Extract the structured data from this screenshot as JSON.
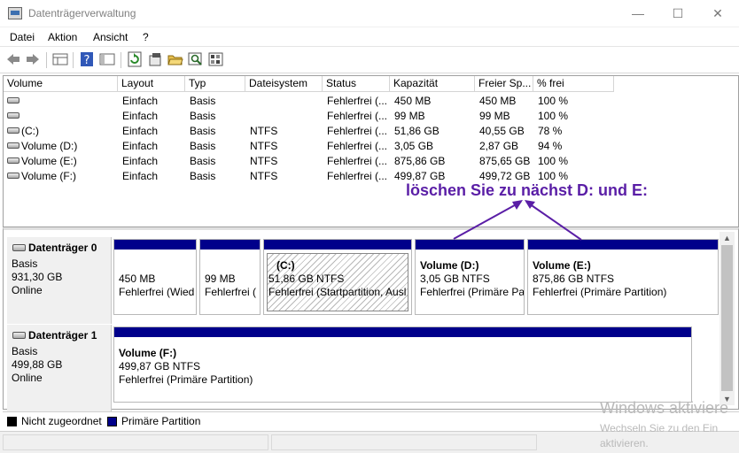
{
  "window": {
    "title": "Datenträgerverwaltung",
    "minimize": "—",
    "maximize": "☐",
    "close": "✕"
  },
  "menu": [
    "Datei",
    "Aktion",
    "Ansicht",
    "?"
  ],
  "toolbar": {
    "icons": [
      "back-arrow-icon",
      "forward-arrow-icon",
      "disk-list-icon",
      "help-icon",
      "console-tree-icon",
      "refresh-icon",
      "properties-icon",
      "open-folder-icon",
      "search-disk-icon",
      "rescan-icon"
    ]
  },
  "columns": [
    "Volume",
    "Layout",
    "Typ",
    "Dateisystem",
    "Status",
    "Kapazität",
    "Freier Sp...",
    "% frei"
  ],
  "volumes": [
    {
      "name": "",
      "layout": "Einfach",
      "type": "Basis",
      "fs": "",
      "status": "Fehlerfrei (...",
      "capacity": "450 MB",
      "free": "450 MB",
      "pct": "100 %"
    },
    {
      "name": "",
      "layout": "Einfach",
      "type": "Basis",
      "fs": "",
      "status": "Fehlerfrei (...",
      "capacity": "99 MB",
      "free": "99 MB",
      "pct": "100 %"
    },
    {
      "name": "(C:)",
      "layout": "Einfach",
      "type": "Basis",
      "fs": "NTFS",
      "status": "Fehlerfrei (...",
      "capacity": "51,86 GB",
      "free": "40,55 GB",
      "pct": "78 %"
    },
    {
      "name": "Volume (D:)",
      "layout": "Einfach",
      "type": "Basis",
      "fs": "NTFS",
      "status": "Fehlerfrei (...",
      "capacity": "3,05 GB",
      "free": "2,87 GB",
      "pct": "94 %"
    },
    {
      "name": "Volume (E:)",
      "layout": "Einfach",
      "type": "Basis",
      "fs": "NTFS",
      "status": "Fehlerfrei (...",
      "capacity": "875,86 GB",
      "free": "875,65 GB",
      "pct": "100 %"
    },
    {
      "name": "Volume (F:)",
      "layout": "Einfach",
      "type": "Basis",
      "fs": "NTFS",
      "status": "Fehlerfrei (...",
      "capacity": "499,87 GB",
      "free": "499,72 GB",
      "pct": "100 %"
    }
  ],
  "annotation": "löschen Sie zu nächst D: und E:",
  "disk0": {
    "name": "Datenträger 0",
    "type": "Basis",
    "size": "931,30 GB",
    "state": "Online",
    "partitions": [
      {
        "title": "",
        "line1": "450 MB",
        "line2": "Fehlerfrei (Wied"
      },
      {
        "title": "",
        "line1": "99 MB",
        "line2": "Fehlerfrei ("
      },
      {
        "title": "(C:)",
        "line1": "51,86 GB NTFS",
        "line2": "Fehlerfrei (Startpartition, Ausl"
      },
      {
        "title": "Volume  (D:)",
        "line1": "3,05 GB NTFS",
        "line2": "Fehlerfrei (Primäre Pa"
      },
      {
        "title": "Volume  (E:)",
        "line1": "875,86 GB NTFS",
        "line2": "Fehlerfrei (Primäre Partition)"
      }
    ]
  },
  "disk1": {
    "name": "Datenträger 1",
    "type": "Basis",
    "size": "499,88 GB",
    "state": "Online",
    "partitions": [
      {
        "title": "Volume  (F:)",
        "line1": "499,87 GB NTFS",
        "line2": "Fehlerfrei (Primäre Partition)"
      }
    ]
  },
  "legend": [
    {
      "label": "Nicht zugeordnet",
      "color": "#000000"
    },
    {
      "label": "Primäre Partition",
      "color": "#00008b"
    }
  ],
  "watermark": {
    "line1": "Windows aktiviere",
    "line2": "Wechseln Sie zu den Ein",
    "line3": "aktivieren."
  },
  "colors": {
    "partition_bar": "#00008b",
    "annotation": "#5a1ea6"
  }
}
